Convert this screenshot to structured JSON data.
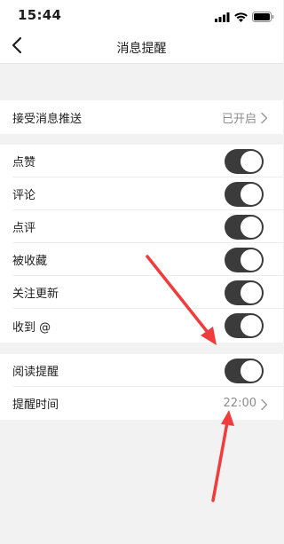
{
  "status_bar": {
    "time": "15:44"
  },
  "header": {
    "title": "消息提醒"
  },
  "push_row": {
    "label": "接受消息推送",
    "value": "已开启"
  },
  "toggles": [
    {
      "label": "点赞",
      "on": true
    },
    {
      "label": "评论",
      "on": true
    },
    {
      "label": "点评",
      "on": true
    },
    {
      "label": "被收藏",
      "on": true
    },
    {
      "label": "关注更新",
      "on": true
    },
    {
      "label": "收到 @",
      "on": true
    }
  ],
  "reading_reminder": {
    "label": "阅读提醒",
    "on": true
  },
  "reminder_time": {
    "label": "提醒时间",
    "value": "22:00"
  },
  "colors": {
    "accent": "#3b3b3b",
    "annotation": "#f03c3c",
    "background": "#f2f2f2"
  }
}
